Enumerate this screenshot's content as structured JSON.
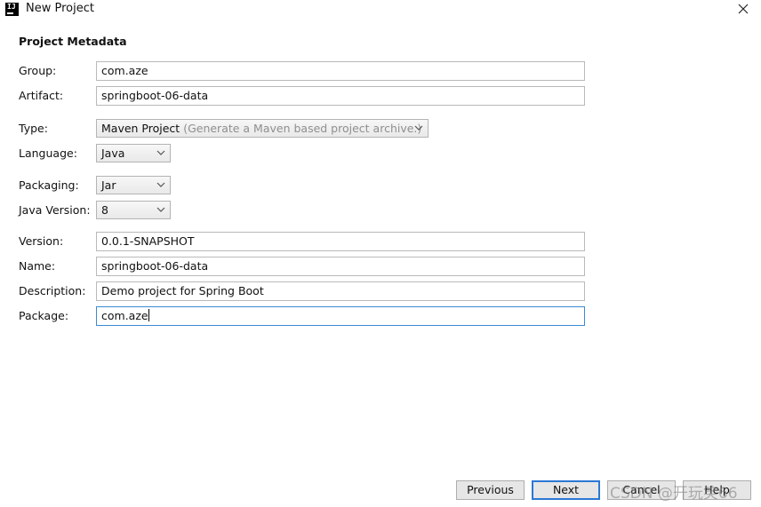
{
  "window": {
    "title": "New Project",
    "app_icon_text": "IJ"
  },
  "section": {
    "heading": "Project Metadata"
  },
  "fields": {
    "group": {
      "label": "Group:",
      "value": "com.aze"
    },
    "artifact": {
      "label": "Artifact:",
      "value": "springboot-06-data"
    },
    "type": {
      "label": "Type:",
      "value": "Maven Project",
      "hint": "(Generate a Maven based project archive.)"
    },
    "language": {
      "label": "Language:",
      "value": "Java"
    },
    "packaging": {
      "label": "Packaging:",
      "value": "Jar"
    },
    "java_version": {
      "label": "Java Version:",
      "value": "8"
    },
    "version": {
      "label": "Version:",
      "value": "0.0.1-SNAPSHOT"
    },
    "name": {
      "label": "Name:",
      "value": "springboot-06-data"
    },
    "description": {
      "label": "Description:",
      "value": "Demo project for Spring Boot"
    },
    "package": {
      "label": "Package:",
      "value": "com.aze"
    }
  },
  "buttons": {
    "previous": "Previous",
    "next": "Next",
    "cancel": "Cancel",
    "help": "Help"
  },
  "watermark": "CSDN @开玩笑66",
  "colors": {
    "focus_border": "#3c8ad1",
    "primary_button_border": "#2b78d4",
    "hint_text": "#8f8f8f"
  },
  "icons": {
    "close": "close-icon",
    "dropdown": "chevron-down-icon"
  }
}
